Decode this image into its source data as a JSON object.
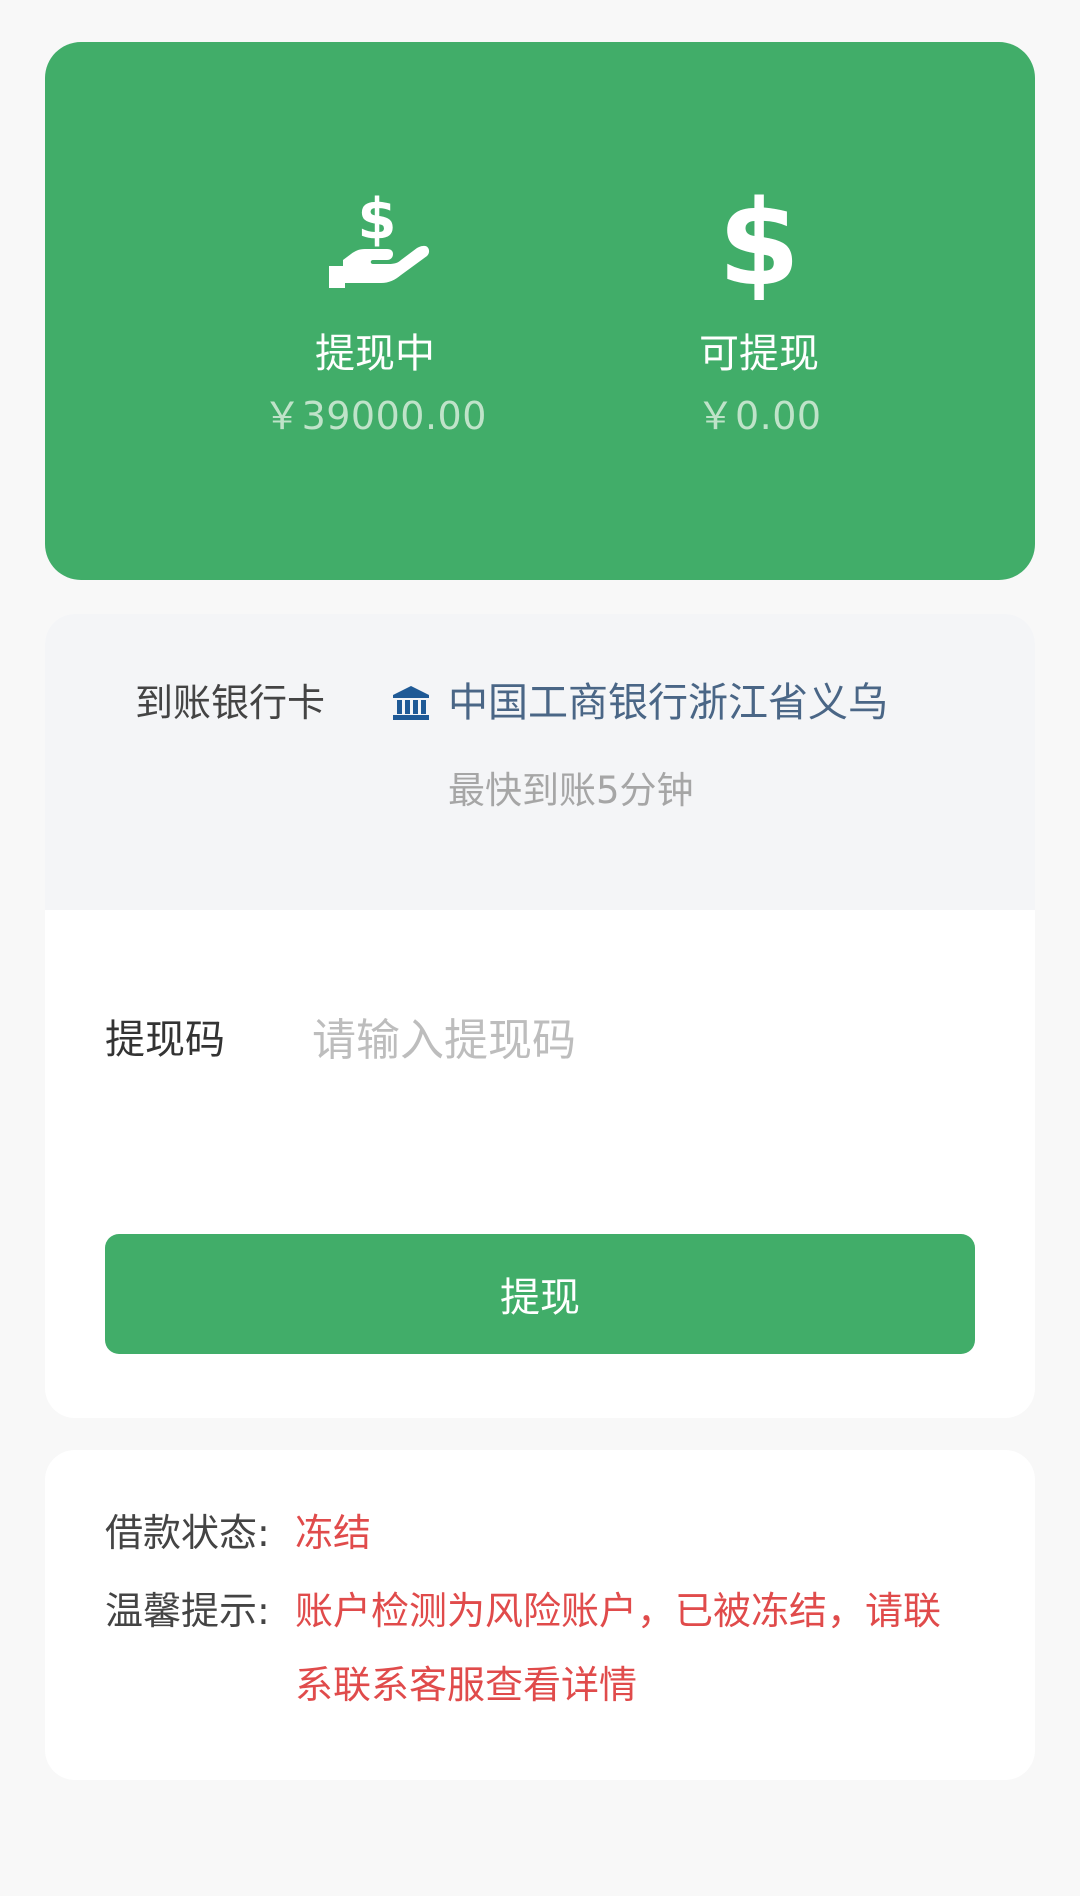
{
  "balances": {
    "withdrawing": {
      "label": "提现中",
      "amount": "￥39000.00",
      "icon": "hand-dollar-icon"
    },
    "available": {
      "label": "可提现",
      "amount": "￥0.00",
      "icon": "dollar-icon"
    }
  },
  "bank": {
    "label": "到账银行卡",
    "icon": "bank-icon",
    "name": "中国工商银行浙江省义乌",
    "arrival_hint": "最快到账5分钟"
  },
  "withdraw_code": {
    "label": "提现码",
    "value": "",
    "placeholder": "请输入提现码"
  },
  "submit_label": "提现",
  "status": {
    "loan_status_label": "借款状态:",
    "loan_status_value": "冻结",
    "tip_label": "温馨提示:",
    "tip_value": "账户检测为风险账户，已被冻结，请联系联系客服查看详情"
  },
  "colors": {
    "brand_green": "#41ad69",
    "alert_red": "#e04b4b",
    "bank_blue": "#1f5a96"
  }
}
